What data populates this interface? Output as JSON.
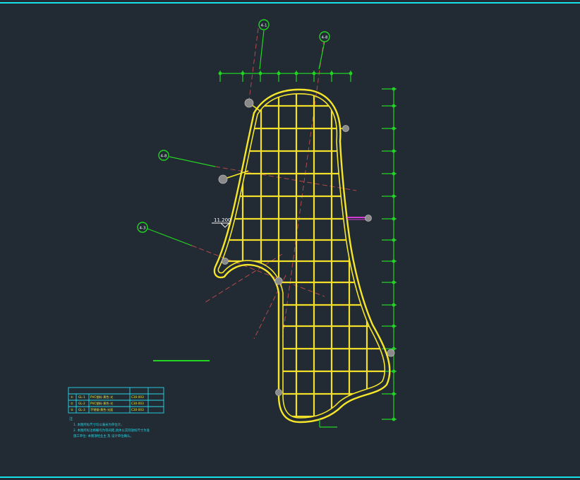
{
  "drawing": {
    "level_mark": "11.200",
    "callouts": [
      {
        "id": "callout-a",
        "label": "4-1"
      },
      {
        "id": "callout-b",
        "label": "4-8"
      },
      {
        "id": "callout-c",
        "label": "4-8"
      },
      {
        "id": "callout-d",
        "label": "4-3"
      }
    ],
    "table": {
      "rows": [
        [
          "①",
          "GL-1",
          "PVC塑料-黄色-光",
          "C30-003"
        ],
        [
          "②",
          "GL-2",
          "PVC塑料-黄色-光",
          "C30-003"
        ],
        [
          "③",
          "GL-3",
          "不锈钢-黄色-光面",
          "C30-003"
        ]
      ]
    },
    "notes": {
      "title": "注",
      "lines": [
        "1. 本图所标尺寸均以毫米为单位计。",
        "2. 本图所标注格栅均为等间距,具体以实际放样尺寸为准",
        "   施工单位: 本图须经业主 及 设计单位确认。"
      ]
    },
    "colors": {
      "background": "#222a33",
      "frame": "#17e0e8",
      "outline": "#f5e62b",
      "grid": "#f2df2a",
      "dimension": "#22d522",
      "cyan_text": "#24d7e6",
      "axis_dashed": "#b54a4a",
      "node": "#8a8a8a",
      "magenta": "#d43bd4"
    }
  }
}
